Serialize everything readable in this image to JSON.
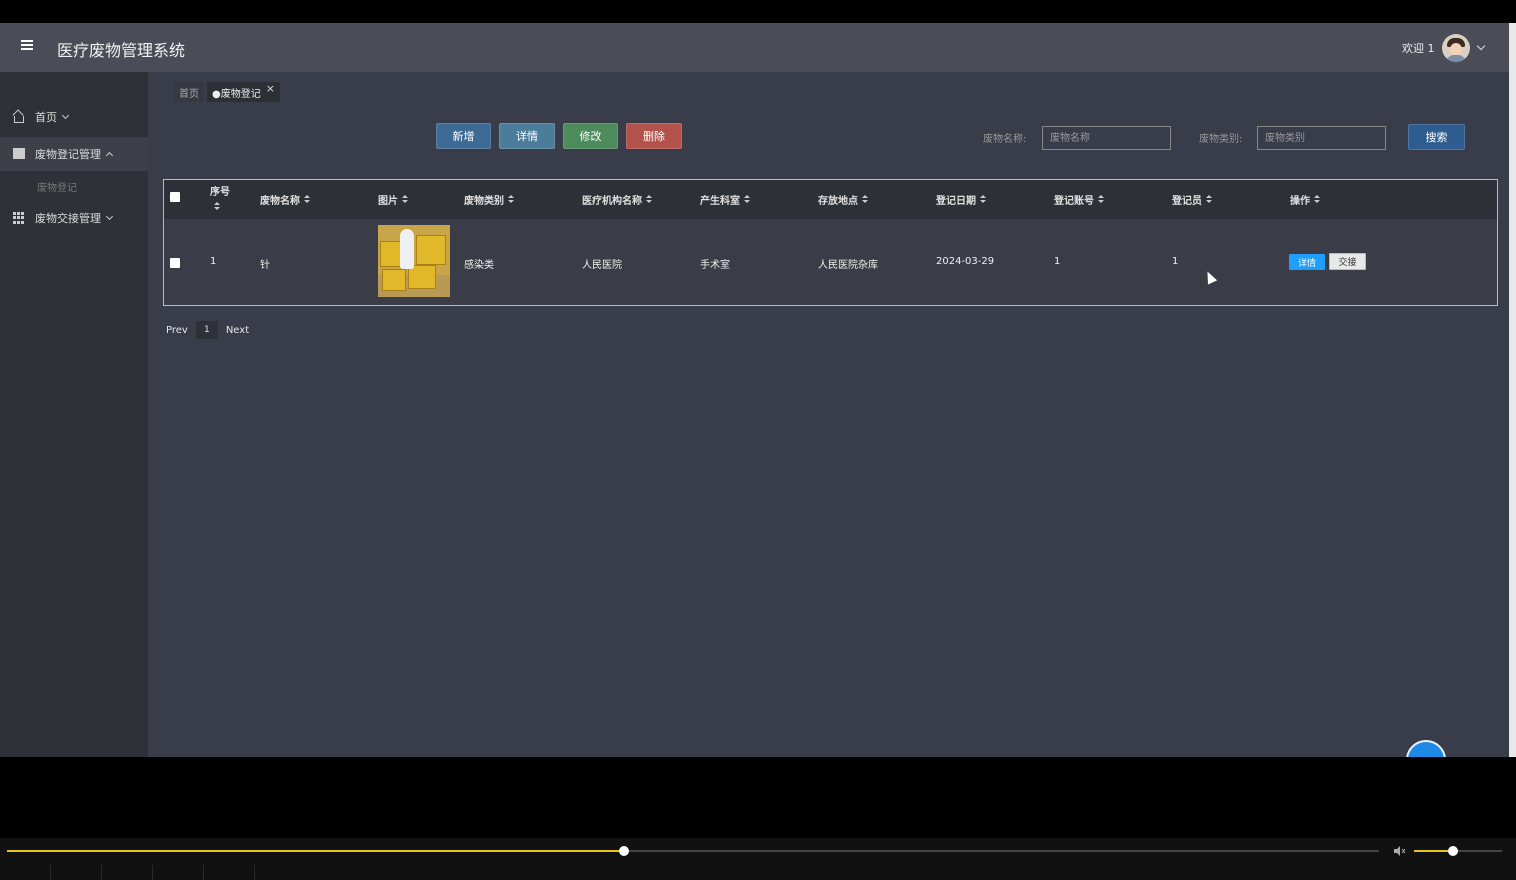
{
  "header": {
    "title": "医疗废物管理系统",
    "welcome": "欢迎 1"
  },
  "sidebar": {
    "items": [
      {
        "label": "首页",
        "icon": "home-icon"
      },
      {
        "label": "废物登记管理",
        "icon": "picture-icon",
        "expanded": true
      },
      {
        "label": "废物交接管理",
        "icon": "grid-icon"
      }
    ],
    "sub_item": "废物登记"
  },
  "tabs": {
    "home": "首页",
    "current": "●废物登记",
    "close": "×"
  },
  "toolbar": {
    "add": "新增",
    "detail": "详情",
    "edit": "修改",
    "delete": "删除"
  },
  "search": {
    "name_label": "废物名称:",
    "name_placeholder": "废物名称",
    "type_label": "废物类别:",
    "type_placeholder": "废物类别",
    "button": "搜索"
  },
  "table": {
    "columns": [
      "序号",
      "废物名称",
      "图片",
      "废物类别",
      "医疗机构名称",
      "产生科室",
      "存放地点",
      "登记日期",
      "登记账号",
      "登记员",
      "操作"
    ],
    "rows": [
      {
        "index": "1",
        "name": "针",
        "category": "感染类",
        "institution": "人民医院",
        "department": "手术室",
        "location": "人民医院杂库",
        "date": "2024-03-29",
        "account": "1",
        "registrar": "1",
        "detail_btn": "详情",
        "handover_btn": "交接"
      }
    ]
  },
  "pager": {
    "prev": "Prev",
    "page": "1",
    "next": "Next"
  },
  "colors": {
    "primary": "#1e9fff",
    "add": "#3e6b95",
    "detail": "#4b7d9b",
    "edit": "#4d8a5c",
    "delete": "#b2524a",
    "search": "#2f5c8f"
  },
  "player": {
    "progress": 0.45,
    "volume": 0.44
  }
}
